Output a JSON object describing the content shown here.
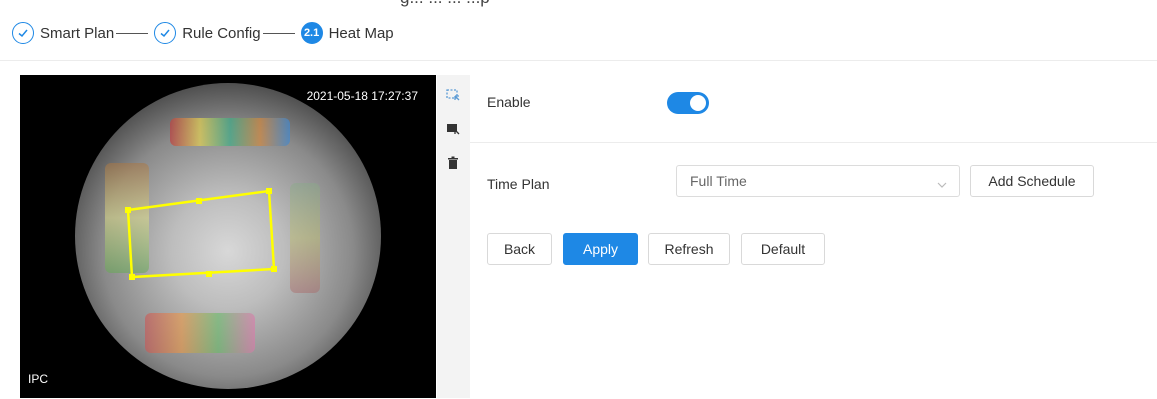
{
  "header_cutoff_text": "g... ... ... ...p",
  "steps": [
    {
      "label": "Smart Plan",
      "state": "done"
    },
    {
      "label": "Rule Config",
      "state": "done"
    },
    {
      "label": "Heat Map",
      "state": "active",
      "number": "2.1"
    }
  ],
  "video": {
    "timestamp": "2021-05-18 17:27:37",
    "channel_label": "IPC"
  },
  "tools": [
    {
      "icon": "draw-area-icon"
    },
    {
      "icon": "clear-area-icon"
    },
    {
      "icon": "trash-icon"
    }
  ],
  "form": {
    "enable_label": "Enable",
    "enable_value": true,
    "time_plan_label": "Time Plan",
    "time_plan_value": "Full Time",
    "add_schedule_label": "Add Schedule"
  },
  "buttons": {
    "back": "Back",
    "apply": "Apply",
    "refresh": "Refresh",
    "default": "Default"
  },
  "colors": {
    "accent": "#1e88e5",
    "roi": "#ffff00"
  }
}
